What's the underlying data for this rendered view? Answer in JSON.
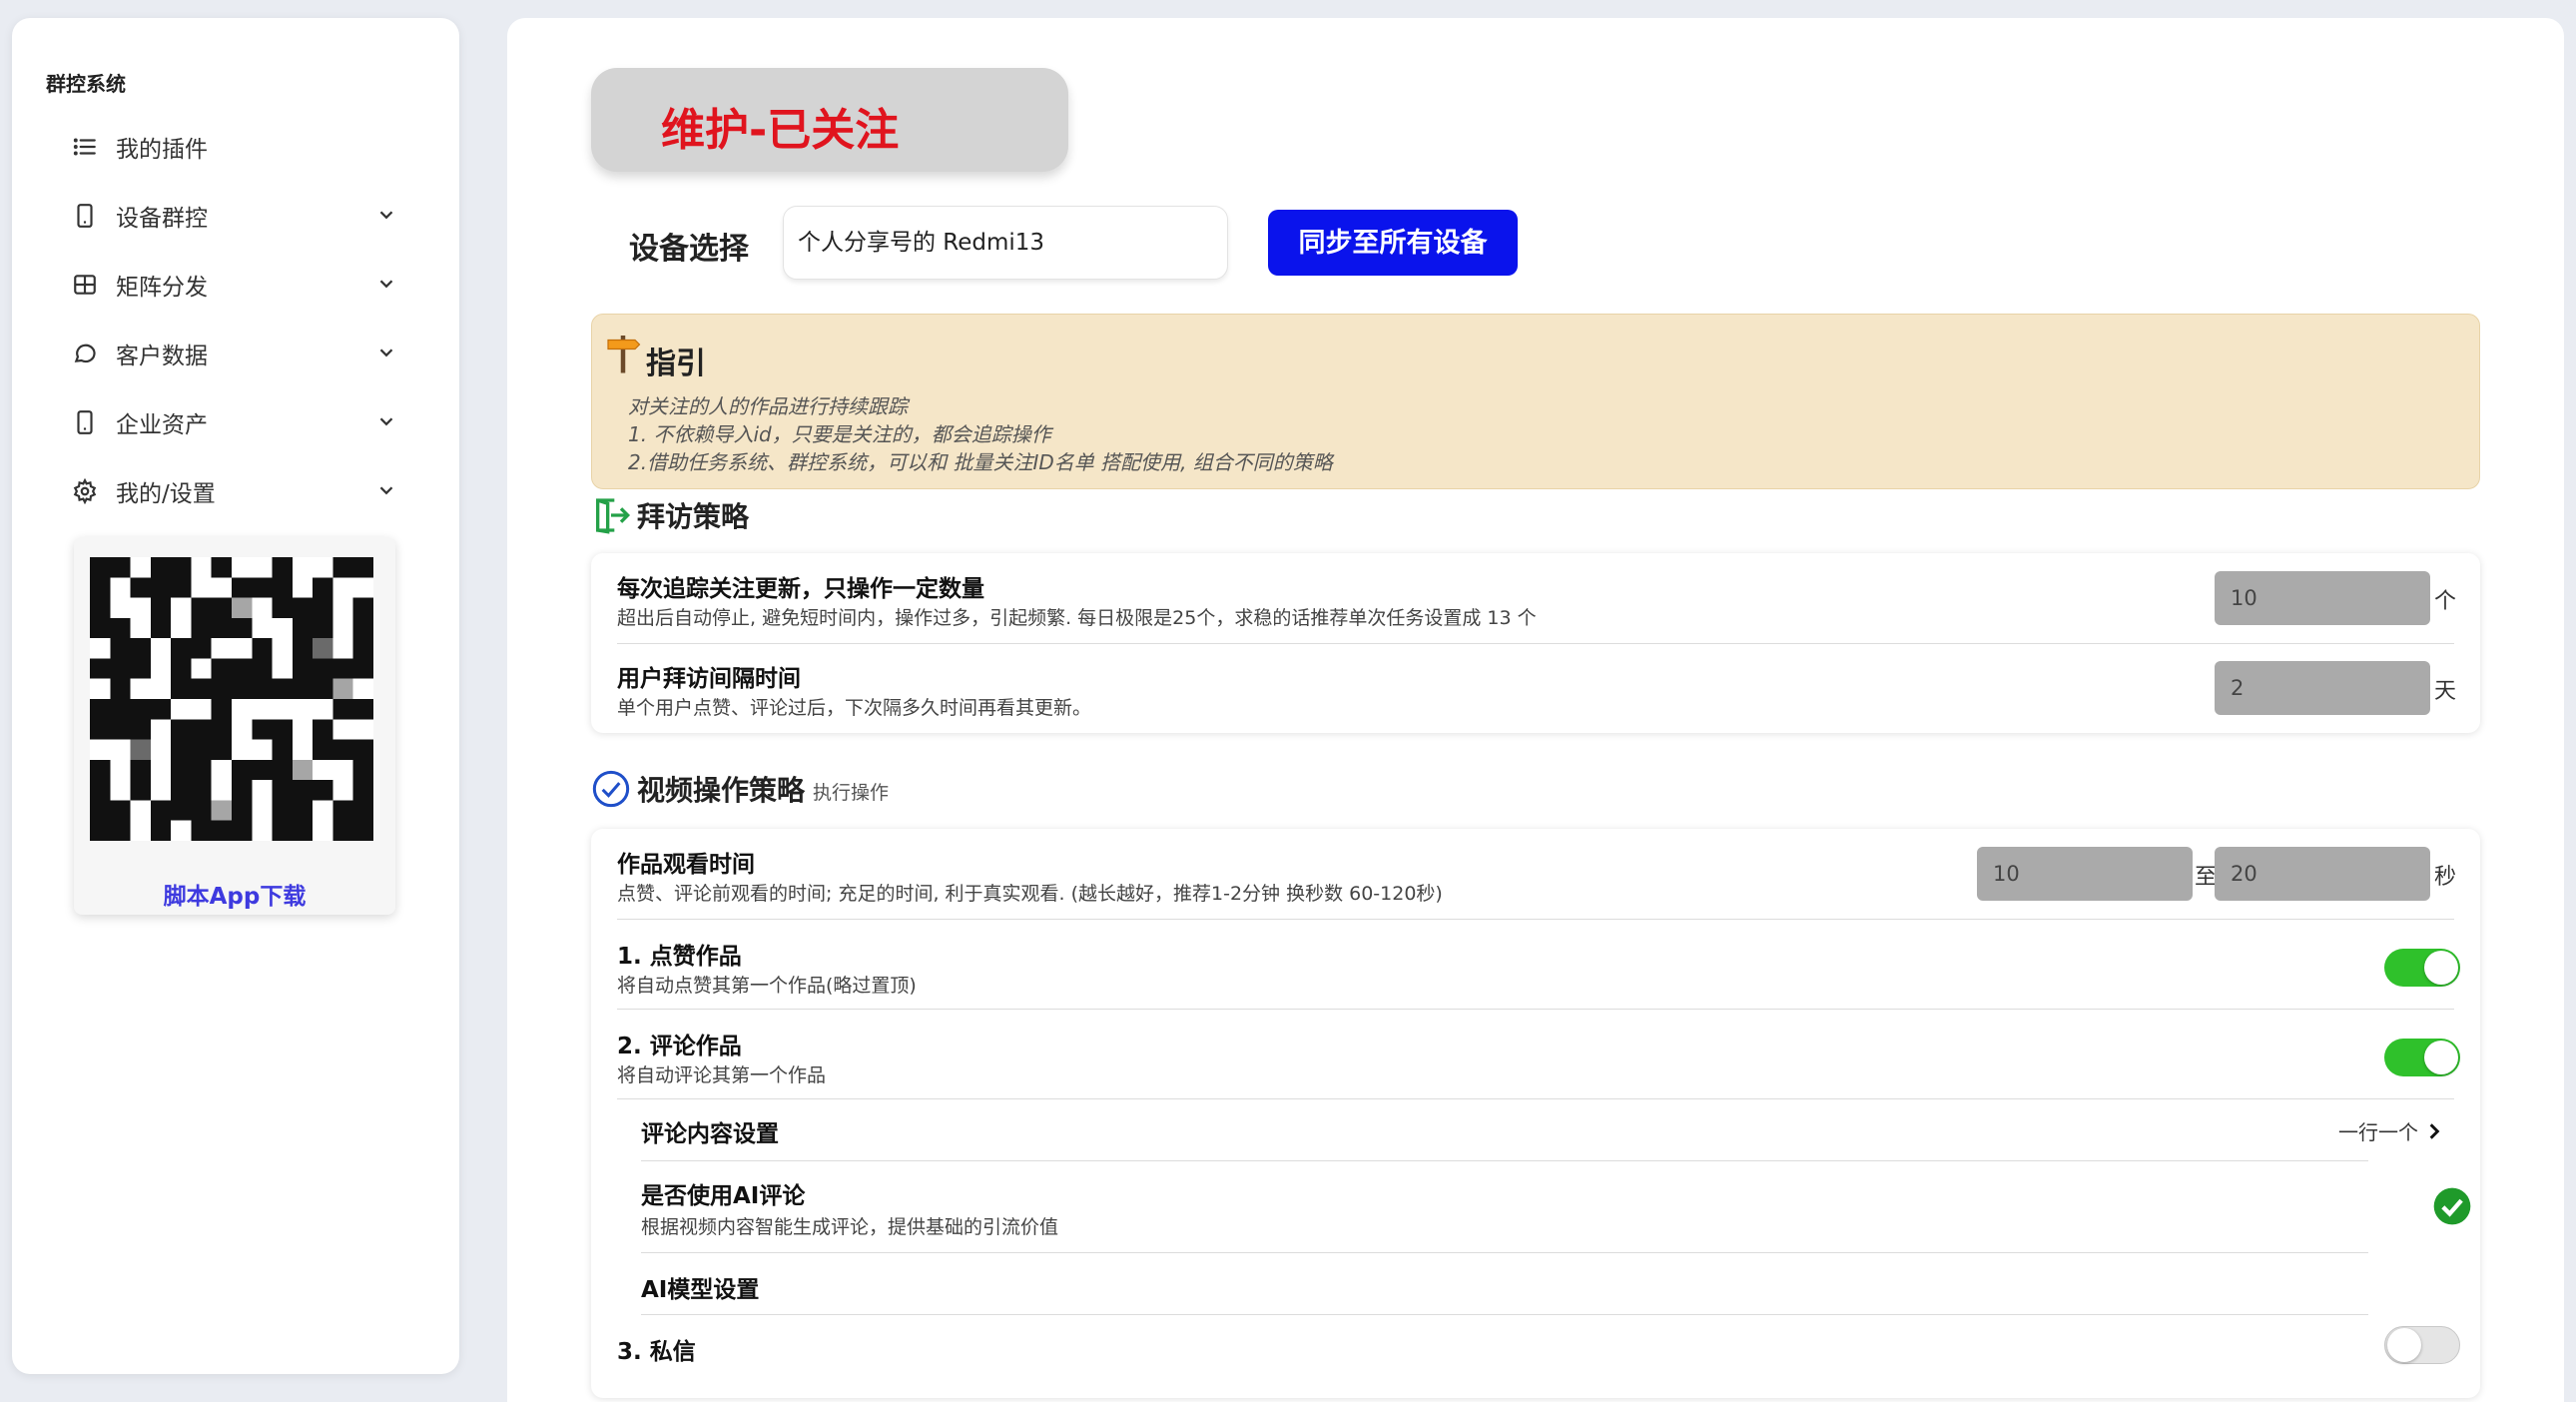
{
  "sidebar": {
    "brand": "群控系统",
    "items": [
      {
        "label": "我的插件",
        "icon": "list-icon",
        "has_submenu": false
      },
      {
        "label": "设备群控",
        "icon": "phone-icon",
        "has_submenu": true
      },
      {
        "label": "矩阵分发",
        "icon": "grid-icon",
        "has_submenu": true
      },
      {
        "label": "客户数据",
        "icon": "chat-bubble-icon",
        "has_submenu": true
      },
      {
        "label": "企业资产",
        "icon": "phone-icon",
        "has_submenu": true
      },
      {
        "label": "我的/设置",
        "icon": "gear-icon",
        "has_submenu": true
      }
    ],
    "download_label": "脚本App下载"
  },
  "header": {
    "title": "维护-已关注",
    "device_label": "设备选择",
    "device_value": "个人分享号的 Redmi13",
    "sync_button": "同步至所有设备"
  },
  "guide": {
    "title": "指引",
    "lines": [
      "对关注的人的作品进行持续跟踪",
      "1. 不依赖导入id，只要是关注的，都会追踪操作",
      "2.借助任务系统、群控系统，可以和 批量关注ID名单  搭配使用, 组合不同的策略"
    ]
  },
  "visit_strategy": {
    "title": "拜访策略",
    "rows": [
      {
        "title": "每次追踪关注更新，只操作一定数量",
        "desc": "超出后自动停止, 避免短时间内，操作过多，引起频繁. 每日极限是25个，求稳的话推荐单次任务设置成 13 个",
        "value": "10",
        "unit": "个"
      },
      {
        "title": "用户拜访间隔时间",
        "desc": "单个用户点赞、评论过后，下次隔多久时间再看其更新。",
        "value": "2",
        "unit": "天"
      }
    ]
  },
  "video_strategy": {
    "title": "视频操作策略",
    "subtitle": "执行操作",
    "watch": {
      "title": "作品观看时间",
      "desc": "点赞、评论前观看的时间; 充足的时间, 利于真实观看. (越长越好，推荐1-2分钟 换秒数 60-120秒)",
      "min": "10",
      "sep": "至",
      "max": "20",
      "unit": "秒"
    },
    "like": {
      "title": "1. 点赞作品",
      "desc": "将自动点赞其第一个作品(略过置顶)",
      "enabled": true
    },
    "comment": {
      "title": "2. 评论作品",
      "desc": "将自动评论其第一个作品",
      "enabled": true,
      "content_setting": {
        "title": "评论内容设置",
        "hint": "一行一个"
      },
      "ai_comment": {
        "title": "是否使用AI评论",
        "desc": "根据视频内容智能生成评论，提供基础的引流价值",
        "checked": true
      },
      "ai_model": {
        "title": "AI模型设置"
      }
    },
    "dm": {
      "title": "3. 私信",
      "enabled": false
    }
  },
  "colors": {
    "accent_blue": "#0a13ec",
    "title_red": "#e0141e",
    "toggle_green": "#2fc12b",
    "guide_bg": "#f5e6c8",
    "link_purple": "#3e3adf"
  }
}
